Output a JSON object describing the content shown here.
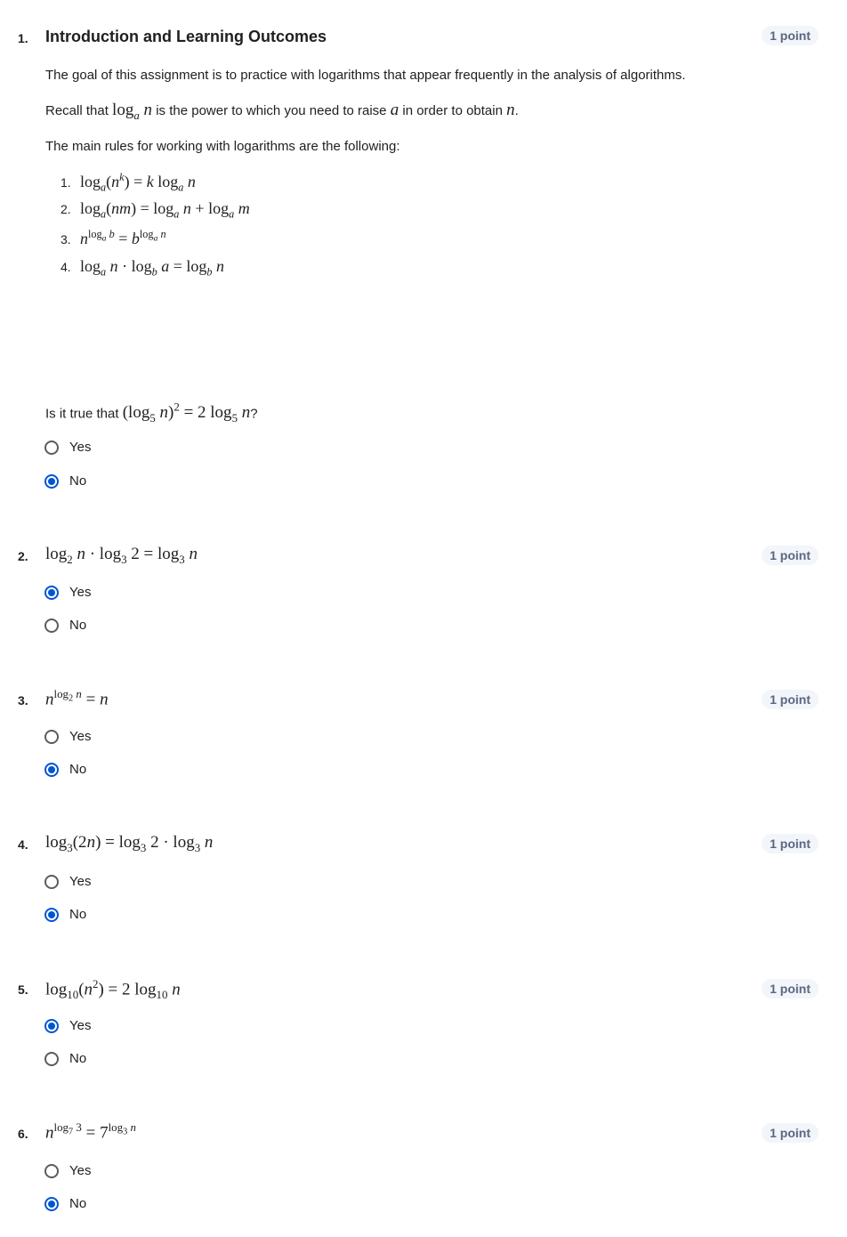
{
  "questions": [
    {
      "number": "1.",
      "title": "Introduction and Learning Outcomes",
      "points": "1 point",
      "intro": "The goal of this assignment is to practice with logarithms that appear frequently in the analysis of algorithms.",
      "recall_prefix": "Recall that",
      "recall_mid": "is the power to which you need to raise",
      "recall_mid2": "in order to obtain",
      "rules_intro": "The main rules for working with logarithms are the following:",
      "rule_numbers": [
        "1.",
        "2.",
        "3.",
        "4."
      ],
      "prompt_prefix": "Is it true that",
      "options": [
        {
          "label": "Yes",
          "checked": false
        },
        {
          "label": "No",
          "checked": true
        }
      ]
    },
    {
      "number": "2.",
      "points": "1 point",
      "options": [
        {
          "label": "Yes",
          "checked": true
        },
        {
          "label": "No",
          "checked": false
        }
      ]
    },
    {
      "number": "3.",
      "points": "1 point",
      "options": [
        {
          "label": "Yes",
          "checked": false
        },
        {
          "label": "No",
          "checked": true
        }
      ]
    },
    {
      "number": "4.",
      "points": "1 point",
      "options": [
        {
          "label": "Yes",
          "checked": false
        },
        {
          "label": "No",
          "checked": true
        }
      ]
    },
    {
      "number": "5.",
      "points": "1 point",
      "options": [
        {
          "label": "Yes",
          "checked": true
        },
        {
          "label": "No",
          "checked": false
        }
      ]
    },
    {
      "number": "6.",
      "points": "1 point",
      "options": [
        {
          "label": "Yes",
          "checked": false
        },
        {
          "label": "No",
          "checked": true
        }
      ]
    }
  ],
  "colors": {
    "accent": "#0056d2",
    "points_text": "#5b6780",
    "points_bg": "#f2f5fa"
  }
}
